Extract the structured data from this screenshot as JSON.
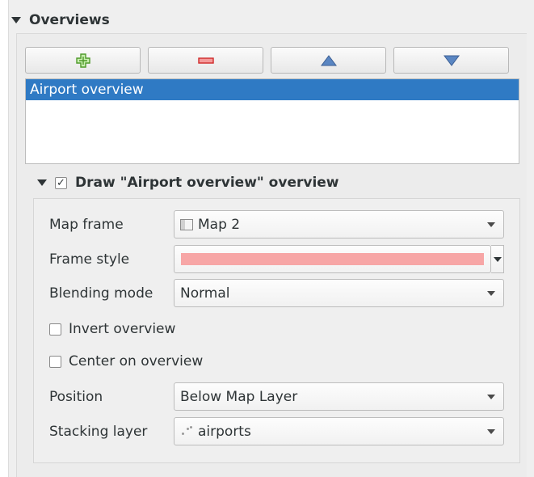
{
  "overviews": {
    "title": "Overviews",
    "toolbar": {
      "add_icon": "plus-green-icon",
      "remove_icon": "minus-red-icon",
      "up_icon": "triangle-up-icon",
      "down_icon": "triangle-down-icon"
    },
    "list": [
      "Airport overview"
    ],
    "selected_index": 0
  },
  "draw_overview": {
    "checked": true,
    "label": "Draw \"Airport overview\" overview",
    "map_frame": {
      "label": "Map frame",
      "value": "Map 2"
    },
    "frame_style": {
      "label": "Frame style",
      "color": "#f7a6a6"
    },
    "blending_mode": {
      "label": "Blending mode",
      "value": "Normal"
    },
    "invert_overview": {
      "label": "Invert overview",
      "checked": false
    },
    "center_on_overview": {
      "label": "Center on overview",
      "checked": false
    },
    "position": {
      "label": "Position",
      "value": "Below Map Layer"
    },
    "stacking_layer": {
      "label": "Stacking layer",
      "value": "airports"
    }
  },
  "colors": {
    "selection": "#2f7ac4",
    "panel_bg": "#efefef",
    "frame_fill": "#f7a6a6"
  }
}
